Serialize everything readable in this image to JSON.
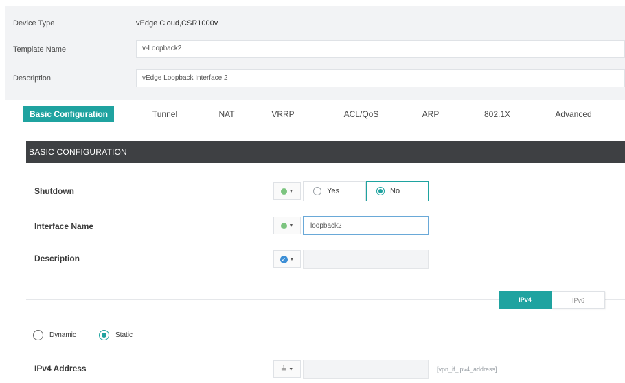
{
  "header": {
    "device_type_label": "Device Type",
    "device_type_value": "vEdge Cloud,CSR1000v",
    "template_name_label": "Template Name",
    "template_name_value": "v-Loopback2",
    "description_label": "Description",
    "description_value": "vEdge Loopback Interface 2"
  },
  "tabs": [
    {
      "label": "Basic Configuration",
      "active": true
    },
    {
      "label": "Tunnel"
    },
    {
      "label": "NAT"
    },
    {
      "label": "VRRP"
    },
    {
      "label": "ACL/QoS"
    },
    {
      "label": "ARP"
    },
    {
      "label": "802.1X"
    },
    {
      "label": "Advanced"
    }
  ],
  "section": {
    "title": "BASIC CONFIGURATION",
    "shutdown": {
      "label": "Shutdown",
      "scope_icon": "globe-icon",
      "options": [
        "Yes",
        "No"
      ],
      "selected": "No"
    },
    "interface_name": {
      "label": "Interface Name",
      "scope_icon": "globe-icon",
      "value": "loopback2"
    },
    "description": {
      "label": "Description",
      "scope_icon": "default-check-icon",
      "value": ""
    },
    "ip_toggle": {
      "options": [
        "IPv4",
        "IPv6"
      ],
      "selected": "IPv4"
    },
    "address_mode": {
      "options": [
        "Dynamic",
        "Static"
      ],
      "selected": "Static"
    },
    "ipv4_address": {
      "label": "IPv4 Address",
      "scope_icon": "device-variable-icon",
      "hint": "[vpn_if_ipv4_address]"
    }
  },
  "colors": {
    "accent": "#1fa3a0",
    "header_bar": "#3e4043",
    "header_bg": "#f2f3f5"
  }
}
